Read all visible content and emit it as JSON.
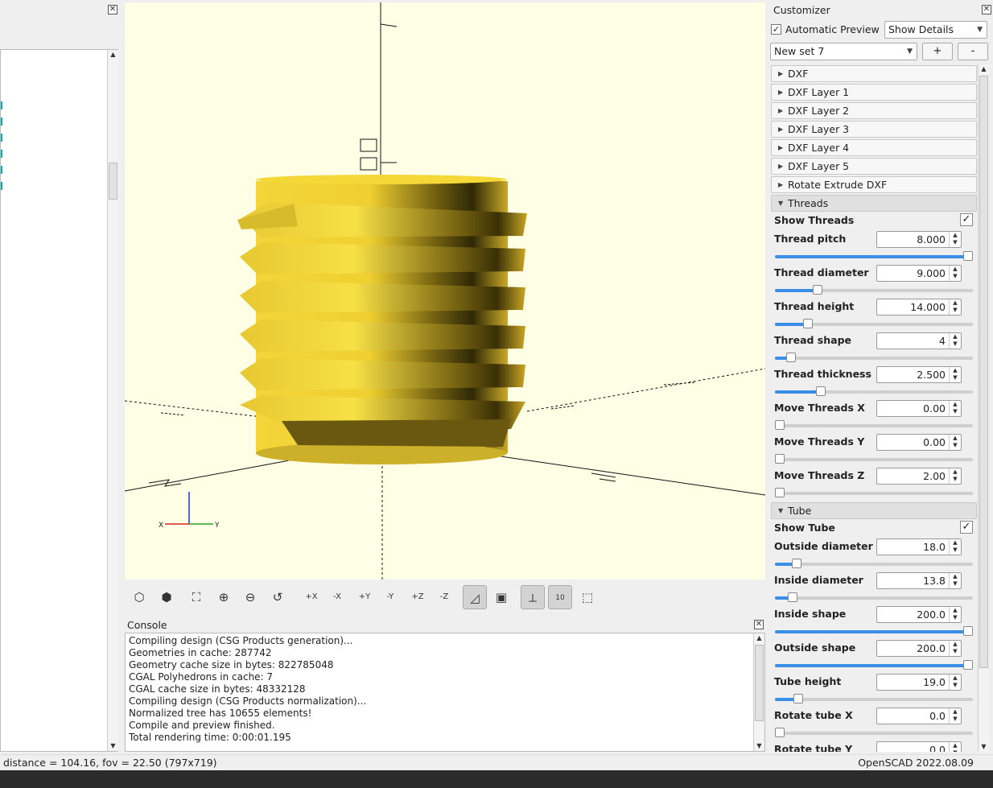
{
  "customizer": {
    "title": "Customizer",
    "auto_preview_label": "Automatic Preview",
    "auto_preview_checked": "✓",
    "details_mode": "Show Details",
    "preset": "New set 7",
    "add_preset": "+",
    "remove_preset": "-",
    "groups_closed": [
      "DXF",
      "DXF Layer 1",
      "DXF Layer 2",
      "DXF Layer 3",
      "DXF Layer 4",
      "DXF Layer 5",
      "Rotate Extrude DXF"
    ],
    "threads": {
      "title": "Threads",
      "show_label": "Show Threads",
      "show_checked": "✓",
      "params": [
        {
          "label": "Thread pitch",
          "value": "8.000",
          "fraction": 1.0
        },
        {
          "label": "Thread diameter",
          "value": "9.000",
          "fraction": 0.2
        },
        {
          "label": "Thread height",
          "value": "14.000",
          "fraction": 0.15
        },
        {
          "label": "Thread shape",
          "value": "4",
          "fraction": 0.06
        },
        {
          "label": "Thread thickness",
          "value": "2.500",
          "fraction": 0.22
        },
        {
          "label": "Move Threads X",
          "value": "0.00",
          "fraction": 0.0
        },
        {
          "label": "Move Threads Y",
          "value": "0.00",
          "fraction": 0.0
        },
        {
          "label": "Move Threads Z",
          "value": "2.00",
          "fraction": 0.0
        }
      ]
    },
    "tube": {
      "title": "Tube",
      "show_label": "Show Tube",
      "show_checked": "✓",
      "params": [
        {
          "label": "Outside diameter",
          "value": "18.0",
          "fraction": 0.09
        },
        {
          "label": "Inside diameter",
          "value": "13.8",
          "fraction": 0.07
        },
        {
          "label": "Inside shape",
          "value": "200.0",
          "fraction": 1.0
        },
        {
          "label": "Outside shape",
          "value": "200.0",
          "fraction": 1.0
        },
        {
          "label": "Tube height",
          "value": "19.0",
          "fraction": 0.1
        },
        {
          "label": "Rotate tube X",
          "value": "0.0",
          "fraction": 0.0
        },
        {
          "label": "Rotate tube Y",
          "value": "0.0",
          "fraction": 0.0
        }
      ]
    }
  },
  "viewport": {
    "axis_label_x": "X",
    "axis_label_y": "Y",
    "scale_marks": [
      "10"
    ]
  },
  "toolbar": {
    "icons": [
      "preview-icon",
      "render-icon",
      "view-all-icon",
      "zoom-in-icon",
      "zoom-out-icon",
      "reset-view-icon",
      "view-right-icon",
      "view-left-icon",
      "view-back-icon",
      "view-front-icon",
      "view-top-icon",
      "view-bottom-icon",
      "perspective-icon",
      "orthogonal-icon",
      "show-axes-icon",
      "show-scale-icon",
      "show-edges-icon"
    ],
    "view_labels": [
      "+X",
      "-X",
      "+Y",
      "-Y",
      "+Z",
      "-Z"
    ]
  },
  "console": {
    "title": "Console",
    "lines": [
      "Compiling design (CSG Products generation)...",
      "Geometries in cache: 287742",
      "Geometry cache size in bytes: 822785048",
      "CGAL Polyhedrons in cache: 7",
      "CGAL cache size in bytes: 48332128",
      "Compiling design (CSG Products normalization)...",
      "Normalized tree has 10655 elements!",
      "Compile and preview finished.",
      "Total rendering time: 0:00:01.195"
    ]
  },
  "status": {
    "left": "distance = 104.16, fov = 22.50 (797x719)",
    "right": "OpenSCAD 2022.08.09"
  },
  "colors": {
    "viewport_bg": "#ffffe5",
    "model_yellow": "#f2d23a",
    "slider_fill": "#3a8ee6"
  }
}
